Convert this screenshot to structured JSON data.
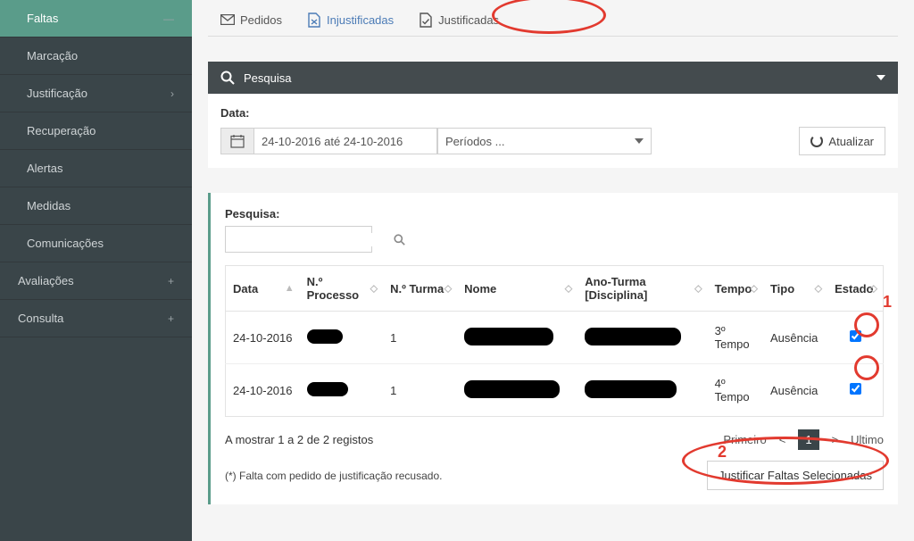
{
  "sidebar": {
    "items": [
      {
        "label": "Faltas"
      },
      {
        "label": "Marcação"
      },
      {
        "label": "Justificação"
      },
      {
        "label": "Recuperação"
      },
      {
        "label": "Alertas"
      },
      {
        "label": "Medidas"
      },
      {
        "label": "Comunicações"
      },
      {
        "label": "Avaliações"
      },
      {
        "label": "Consulta"
      }
    ]
  },
  "tabs": {
    "pedidos": "Pedidos",
    "injustificadas": "Injustificadas",
    "justificadas": "Justificadas"
  },
  "searchPanel": {
    "title": "Pesquisa",
    "dataLabel": "Data:",
    "dateValue": "24-10-2016 até 24-10-2016",
    "periodsPlaceholder": "Períodos ...",
    "updateLabel": "Atualizar"
  },
  "results": {
    "searchLabel": "Pesquisa:",
    "columns": {
      "data": "Data",
      "nprocesso": "N.º Processo",
      "nturma": "N.º Turma",
      "nome": "Nome",
      "anoturma": "Ano-Turma [Disciplina]",
      "tempo": "Tempo",
      "tipo": "Tipo",
      "estado": "Estado"
    },
    "rows": [
      {
        "data": "24-10-2016",
        "nturma": "1",
        "tempo": "3º Tempo",
        "tipo": "Ausência"
      },
      {
        "data": "24-10-2016",
        "nturma": "1",
        "tempo": "4º Tempo",
        "tipo": "Ausência"
      }
    ],
    "showing": "A mostrar 1 a 2 de 2 registos",
    "pager": {
      "first": "Primeiro",
      "prev": "<",
      "current": "1",
      "next": ">",
      "last": "Ultimo"
    },
    "footnote": "(*) Falta com pedido de justificação recusado.",
    "justifyBtn": "Justificar Faltas Selecionadas"
  },
  "annotations": {
    "num1": "1",
    "num2": "2"
  }
}
